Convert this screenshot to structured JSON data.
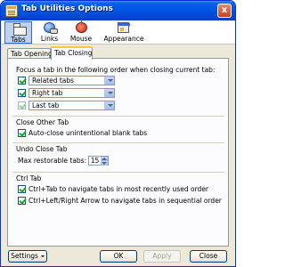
{
  "window": {
    "title": "Tab Utilities Options",
    "close_glyph": "x"
  },
  "toolbar": {
    "items": [
      {
        "label": "Tabs",
        "icon": "tabs-icon",
        "selected": true
      },
      {
        "label": "Links",
        "icon": "links-icon",
        "selected": false
      },
      {
        "label": "Mouse",
        "icon": "mouse-icon",
        "selected": false
      },
      {
        "label": "Appearance",
        "icon": "appearance-icon",
        "selected": false
      }
    ]
  },
  "tabs": [
    {
      "label": "Tab Opening",
      "active": false
    },
    {
      "label": "Tab Closing",
      "active": true
    }
  ],
  "focus_group": {
    "title": "Focus a tab in the following order when closing current tab:",
    "rows": [
      {
        "checked": true,
        "value": "Related tabs",
        "enabled": true
      },
      {
        "checked": true,
        "value": "Right tab",
        "enabled": true
      },
      {
        "checked": true,
        "value": "Last tab",
        "enabled": false
      }
    ]
  },
  "close_other_group": {
    "title": "Close Other Tab",
    "auto_close": {
      "checked": true,
      "label": "Auto-close unintentional blank tabs"
    }
  },
  "undo_group": {
    "title": "Undo Close Tab",
    "max_label": "Max restorable tabs:",
    "max_value": "15"
  },
  "ctrl_group": {
    "title": "Ctrl Tab",
    "options": [
      {
        "checked": true,
        "label": "Ctrl+Tab to navigate tabs in most recently used order"
      },
      {
        "checked": true,
        "label": "Ctrl+Left/Right Arrow to navigate tabs in sequential order"
      }
    ]
  },
  "buttons": {
    "settings": "Settings",
    "ok": "OK",
    "apply": "Apply",
    "close": "Close"
  },
  "colors": {
    "titlebar": "#0054e3",
    "dialog_bg": "#ece9d8",
    "active_tab_accent": "#ffc83c",
    "checkmark": "#21a121"
  }
}
